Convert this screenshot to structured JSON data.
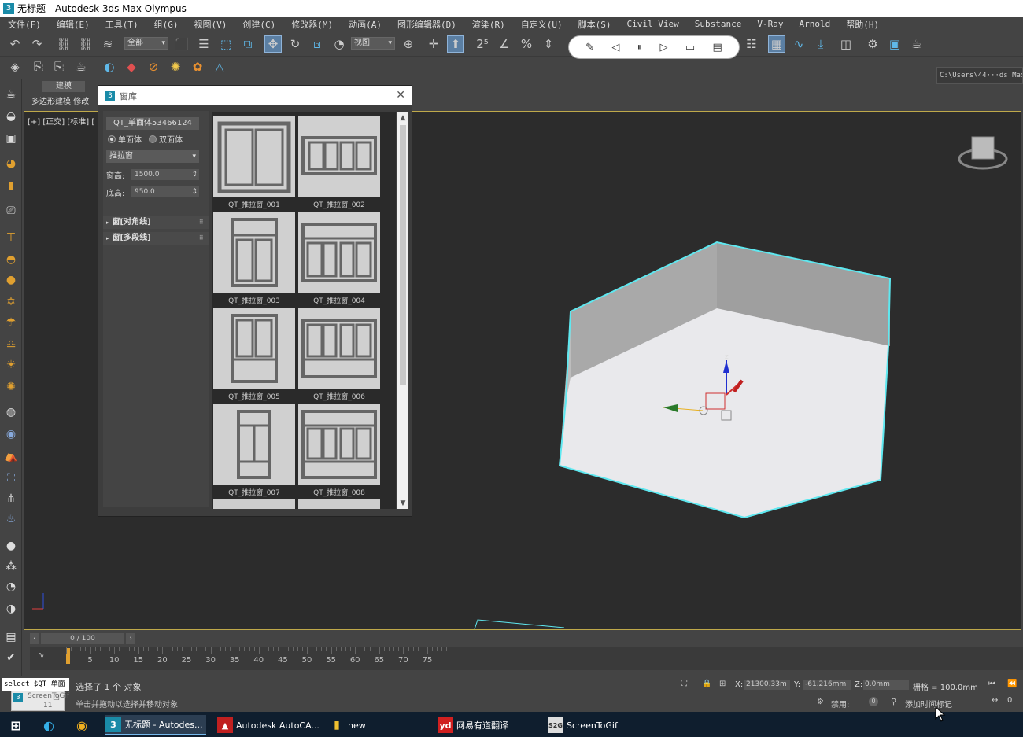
{
  "window": {
    "title": "无标题 - Autodesk 3ds Max Olympus",
    "app_icon": "3"
  },
  "menu": [
    "文件(F)",
    "编辑(E)",
    "工具(T)",
    "组(G)",
    "视图(V)",
    "创建(C)",
    "修改器(M)",
    "动画(A)",
    "图形编辑器(D)",
    "渲染(R)",
    "自定义(U)",
    "脚本(S)",
    "Civil View",
    "Substance",
    "V-Ray",
    "Arnold",
    "帮助(H)"
  ],
  "toolbar": {
    "selection_filter": "全部",
    "ref_coord": "视图",
    "path": "C:\\Users\\44···ds Max 2"
  },
  "ribbon": {
    "tab_modeling": "建模",
    "sub_label": "多边形建模",
    "sub_label2": "修改"
  },
  "viewport": {
    "label": "[+] [正交] [标准] [",
    "accent": "#5ee8f0"
  },
  "dialog": {
    "title": "窗库",
    "name_button": "QT_单面体53466124",
    "radio_single": "单面体",
    "radio_double": "双面体",
    "type": "推拉窗",
    "height_label": "窗高:",
    "height_value": "1500.0",
    "sill_label": "底高:",
    "sill_value": "950.0",
    "rollout1": "窗[对角线]",
    "rollout2": "窗[多段线]",
    "items": [
      "QT_推拉窗_001",
      "QT_推拉窗_002",
      "QT_推拉窗_003",
      "QT_推拉窗_004",
      "QT_推拉窗_005",
      "QT_推拉窗_006",
      "QT_推拉窗_007",
      "QT_推拉窗_008"
    ]
  },
  "timeline": {
    "frame": "0 / 100",
    "ticks": [
      "5",
      "10",
      "15",
      "20",
      "25",
      "30",
      "35",
      "40",
      "45",
      "50",
      "55",
      "60",
      "65",
      "70",
      "75"
    ]
  },
  "status": {
    "maxscript": "select $QT_单面",
    "selected": "选择了 1 个 对象",
    "hint": "单击并拖动以选择并移动对象",
    "x_label": "X:",
    "x_value": "21300.33m",
    "y_label": "Y:",
    "y_value": "-61.216mm",
    "z_label": "Z:",
    "z_value": "0.0mm",
    "grid": "栅格 = 100.0mm",
    "disabled": "禁用:",
    "add_marker": "添加时间标记",
    "zero": "0",
    "gif_tooltip": "ScreenToGif",
    "gif_num": "11"
  },
  "taskbar": {
    "items": [
      "无标题 - Autodes...",
      "Autodesk AutoCA...",
      "new",
      "网易有道翻译",
      "ScreenToGif"
    ]
  }
}
